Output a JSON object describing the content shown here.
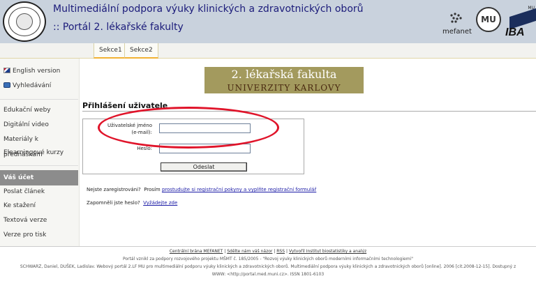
{
  "header": {
    "title1": "Multimediální podpora výuky klinických a zdravotnických oborů",
    "title2": ":: Portál 2. lékařské fakulty",
    "logo_mefanet": "mefanet",
    "logo_iba": "IBA",
    "logo_mu": "MU",
    "emblem_text": "MU"
  },
  "tabs": [
    {
      "label": "Sekce1"
    },
    {
      "label": "Sekce2"
    }
  ],
  "sidebar": {
    "items": [
      {
        "label": "English version",
        "icon": "uk-flag-icon"
      },
      {
        "label": "Vyhledávání",
        "icon": "search-icon"
      },
      {
        "label": "Edukační weby"
      },
      {
        "label": "Digitální video"
      },
      {
        "label": "Materiály k přednáškám"
      },
      {
        "label": "Elearningové kurzy"
      },
      {
        "label": "Váš účet"
      },
      {
        "label": "Poslat článek"
      },
      {
        "label": "Ke stažení"
      },
      {
        "label": "Textová verze"
      },
      {
        "label": "Verze pro tisk"
      }
    ]
  },
  "banner": {
    "line1": "2. lékařská fakulta",
    "line2": "UNIVERZITY KARLOVY"
  },
  "login": {
    "title": "Přihlášení uživatele",
    "username_label": "Uživatelské jméno (e-mail):",
    "password_label": "Heslo:",
    "username_value": "",
    "password_value": "",
    "submit_label": "Odeslat"
  },
  "register": {
    "question": "Nejste zaregistrováni?",
    "prefix": "Prosím",
    "link": "prostudujte si registrační pokyny a vyplňte registrační formulář"
  },
  "forgot": {
    "question": "Zapomněli jste heslo?",
    "link": "Vyžádejte zde"
  },
  "footer": {
    "links": [
      "Centrální brána MEFANET",
      "Sdělte nám váš názor",
      "RSS",
      "Vytvořil Institut biostatistiky a analýz"
    ],
    "separator": "|",
    "line2": "Portál vznikl za podpory rozvojového projektu MŠMT č. 185/2005 - \"Rozvoj výuky klinických oborů moderními informačními technologiemi\"",
    "line3": "SCHWARZ, Daniel, DUŠEK, Ladislav. Webový portál 2.LF MU pro multimediální podporu výuky klinických a zdravotnických oborů. Multimediální podpora výuky klinických a zdravotnických oborů [online]. 2006 [cit.2008-12-15]. Dostupný z",
    "line4": "WWW: <http://portal.med.muni.cz>. ISSN 1801-6103"
  },
  "colors": {
    "header_bg": "#c9d2dd",
    "title_blue": "#1b1b7a",
    "banner_bg": "#a39a5e",
    "highlight_red": "#e0142a",
    "active_item_bg": "#8c8c8c",
    "tab_accent": "#f2b233"
  }
}
